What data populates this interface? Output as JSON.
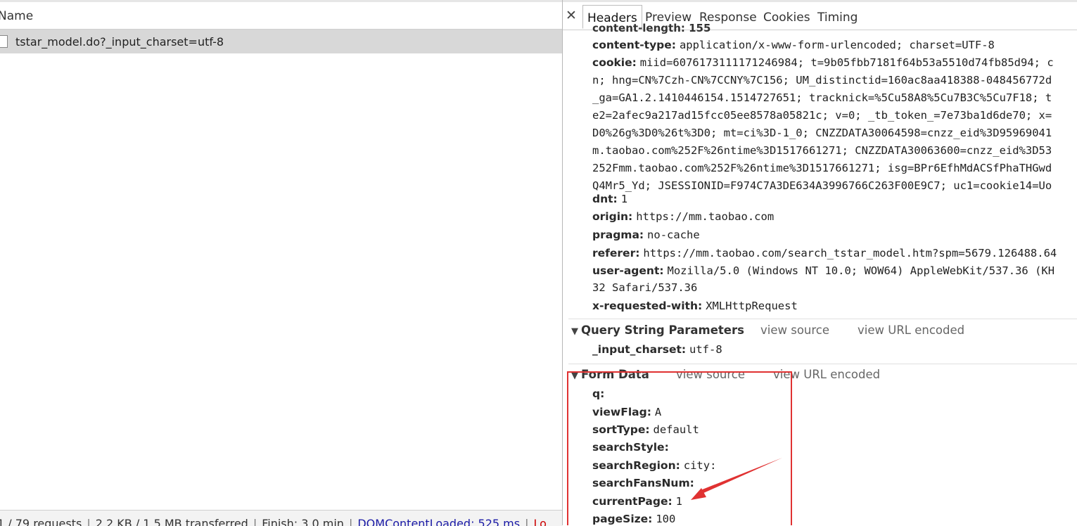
{
  "left_pane": {
    "column_header": "Name",
    "request": {
      "name": "tstar_model.do?_input_charset=utf-8"
    },
    "status_bar": {
      "requests": "1 / 79 requests",
      "transferred": "2.2 KB / 1.5 MB transferred",
      "finish": "Finish: 3.0 min",
      "dom_content_loaded": "DOMContentLoaded: 525 ms",
      "load": "Lo"
    }
  },
  "details": {
    "close_icon": "close-icon",
    "tabs": [
      {
        "label": "Headers",
        "active": true
      },
      {
        "label": "Preview",
        "active": false
      },
      {
        "label": "Response",
        "active": false
      },
      {
        "label": "Cookies",
        "active": false
      },
      {
        "label": "Timing",
        "active": false
      }
    ],
    "clipped_header": "content-length: 155",
    "request_headers": [
      {
        "key": "content-type:",
        "value": "application/x-www-form-urlencoded; charset=UTF-8"
      },
      {
        "key": "cookie:",
        "value": "miid=6076173111171246984; t=9b05fbb7181f64b53a5510d74fb85d94; c"
      },
      {
        "key": "dnt:",
        "value": "1"
      },
      {
        "key": "origin:",
        "value": "https://mm.taobao.com"
      },
      {
        "key": "pragma:",
        "value": "no-cache"
      },
      {
        "key": "referer:",
        "value": "https://mm.taobao.com/search_tstar_model.htm?spm=5679.126488.64"
      },
      {
        "key": "user-agent:",
        "value": "Mozilla/5.0 (Windows NT 10.0; WOW64) AppleWebKit/537.36 (KH"
      },
      {
        "key": "x-requested-with:",
        "value": "XMLHttpRequest"
      }
    ],
    "cookie_continuation": [
      "n; hng=CN%7Czh-CN%7CCNY%7C156; UM_distinctid=160ac8aa418388-048456772d",
      "_ga=GA1.2.1410446154.1514727651; tracknick=%5Cu58A8%5Cu7B3C%5Cu7F18; t",
      "e2=2afec9a217ad15fcc05ee8578a05821c; v=0; _tb_token_=7e73ba1d6de70; x=",
      "D0%26g%3D0%26t%3D0; mt=ci%3D-1_0; CNZZDATA30064598=cnzz_eid%3D95969041",
      "m.taobao.com%252F%26ntime%3D1517661271; CNZZDATA30063600=cnzz_eid%3D53",
      "252Fmm.taobao.com%252F%26ntime%3D1517661271; isg=BPr6EfhMdACSfPhaTHGwd",
      "Q4Mr5_Yd; JSESSIONID=F974C7A3DE634A3996766C263F00E9C7; uc1=cookie14=Uo"
    ],
    "user_agent_continuation": "32 Safari/537.36",
    "query_string": {
      "title": "Query String Parameters",
      "view_source": "view source",
      "view_url_encoded": "view URL encoded",
      "params": [
        {
          "key": "_input_charset:",
          "value": "utf-8"
        }
      ]
    },
    "form_data": {
      "title": "Form Data",
      "view_source": "view source",
      "view_url_encoded": "view URL encoded",
      "params": [
        {
          "key": "q:",
          "value": ""
        },
        {
          "key": "viewFlag:",
          "value": "A"
        },
        {
          "key": "sortType:",
          "value": "default"
        },
        {
          "key": "searchStyle:",
          "value": ""
        },
        {
          "key": "searchRegion:",
          "value": "city:"
        },
        {
          "key": "searchFansNum:",
          "value": ""
        },
        {
          "key": "currentPage:",
          "value": "1"
        },
        {
          "key": "pageSize:",
          "value": "100"
        }
      ]
    },
    "annotation_color": "#e03232"
  }
}
